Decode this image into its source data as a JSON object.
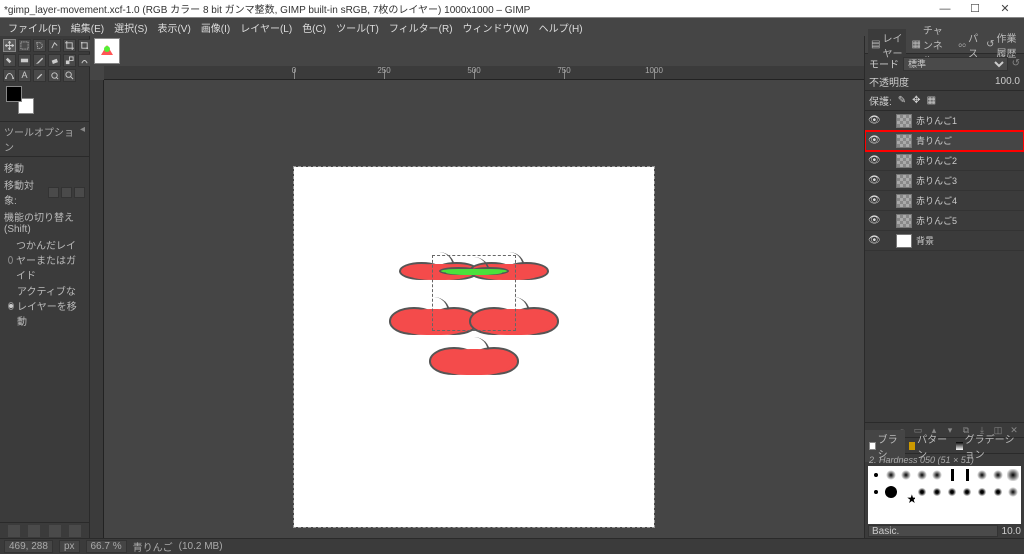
{
  "window": {
    "title": "*gimp_layer-movement.xcf-1.0 (RGB カラー 8 bit ガンマ整数, GIMP built-in sRGB, 7枚のレイヤー) 1000x1000 – GIMP",
    "min": "—",
    "max": "☐",
    "close": "✕"
  },
  "menubar": [
    "ファイル(F)",
    "編集(E)",
    "選択(S)",
    "表示(V)",
    "画像(I)",
    "レイヤー(L)",
    "色(C)",
    "ツール(T)",
    "フィルター(R)",
    "ウィンドウ(W)",
    "ヘルプ(H)"
  ],
  "tool_options": {
    "title": "ツールオプション",
    "tool_name": "移動",
    "target_label": "移動対象:",
    "toggle_label": "機能の切り替え (Shift)",
    "radio1": "つかんだレイヤーまたはガイド",
    "radio2": "アクティブなレイヤーを移動"
  },
  "docks": {
    "tabs": [
      "レイヤー",
      "チャンネル",
      "パス",
      "作業履歴"
    ],
    "mode_label": "モード",
    "mode_value": "標準",
    "opacity_label": "不透明度",
    "opacity_value": "100.0",
    "lock_label": "保護:"
  },
  "layers": [
    {
      "name": "赤りんご1",
      "visible": true,
      "thumb": "checker"
    },
    {
      "name": "青りんご",
      "visible": true,
      "thumb": "checker",
      "highlight": true
    },
    {
      "name": "赤りんご2",
      "visible": true,
      "thumb": "checker"
    },
    {
      "name": "赤りんご3",
      "visible": true,
      "thumb": "checker"
    },
    {
      "name": "赤りんご4",
      "visible": true,
      "thumb": "checker"
    },
    {
      "name": "赤りんご5",
      "visible": true,
      "thumb": "checker"
    },
    {
      "name": "背景",
      "visible": true,
      "thumb": "white"
    }
  ],
  "brush_panel": {
    "tabs": [
      "ブラシ",
      "パターン",
      "グラデーション"
    ],
    "header": "2. Hardness 050 (51 × 51)",
    "preset": "Basic.",
    "spacing": "10.0"
  },
  "statusbar": {
    "coord": "469, 288",
    "unit": "px",
    "zoom": "66.7 %",
    "layer_name": "青りんご",
    "filesize": "(10.2 MB)"
  },
  "ruler_labels": [
    "0",
    "250",
    "500",
    "750",
    "1000"
  ]
}
